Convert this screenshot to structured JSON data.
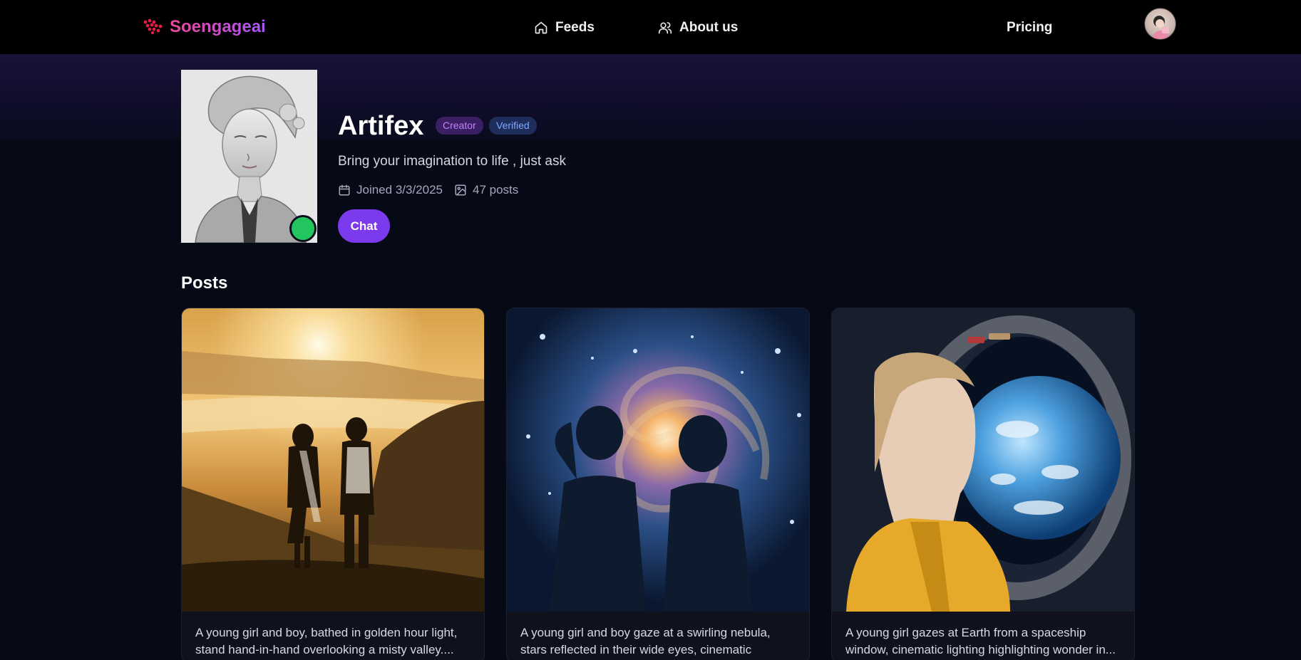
{
  "nav": {
    "brand": "Soengageai",
    "links": [
      {
        "label": "Feeds",
        "icon": "home-icon"
      },
      {
        "label": "About us",
        "icon": "users-icon"
      }
    ],
    "pricing": "Pricing"
  },
  "profile": {
    "name": "Artifex",
    "badges": [
      "Creator",
      "Verified"
    ],
    "bio": "Bring your imagination to life , just ask",
    "joined": "Joined 3/3/2025",
    "posts_count": "47 posts",
    "chat_label": "Chat",
    "online": true
  },
  "posts_section": {
    "title": "Posts",
    "items": [
      {
        "caption": "A young girl and boy, bathed in golden hour light, stand hand-in-hand overlooking a misty valley...."
      },
      {
        "caption": "A young girl and boy gaze at a swirling nebula, stars reflected in their wide eyes, cinematic lighting,..."
      },
      {
        "caption": "A young girl gazes at Earth from a spaceship window, cinematic lighting highlighting wonder in..."
      }
    ]
  },
  "colors": {
    "accent": "#7c3aed",
    "online": "#22c55e",
    "brand_gradient_start": "#ec4899",
    "brand_gradient_end": "#a855f7"
  }
}
